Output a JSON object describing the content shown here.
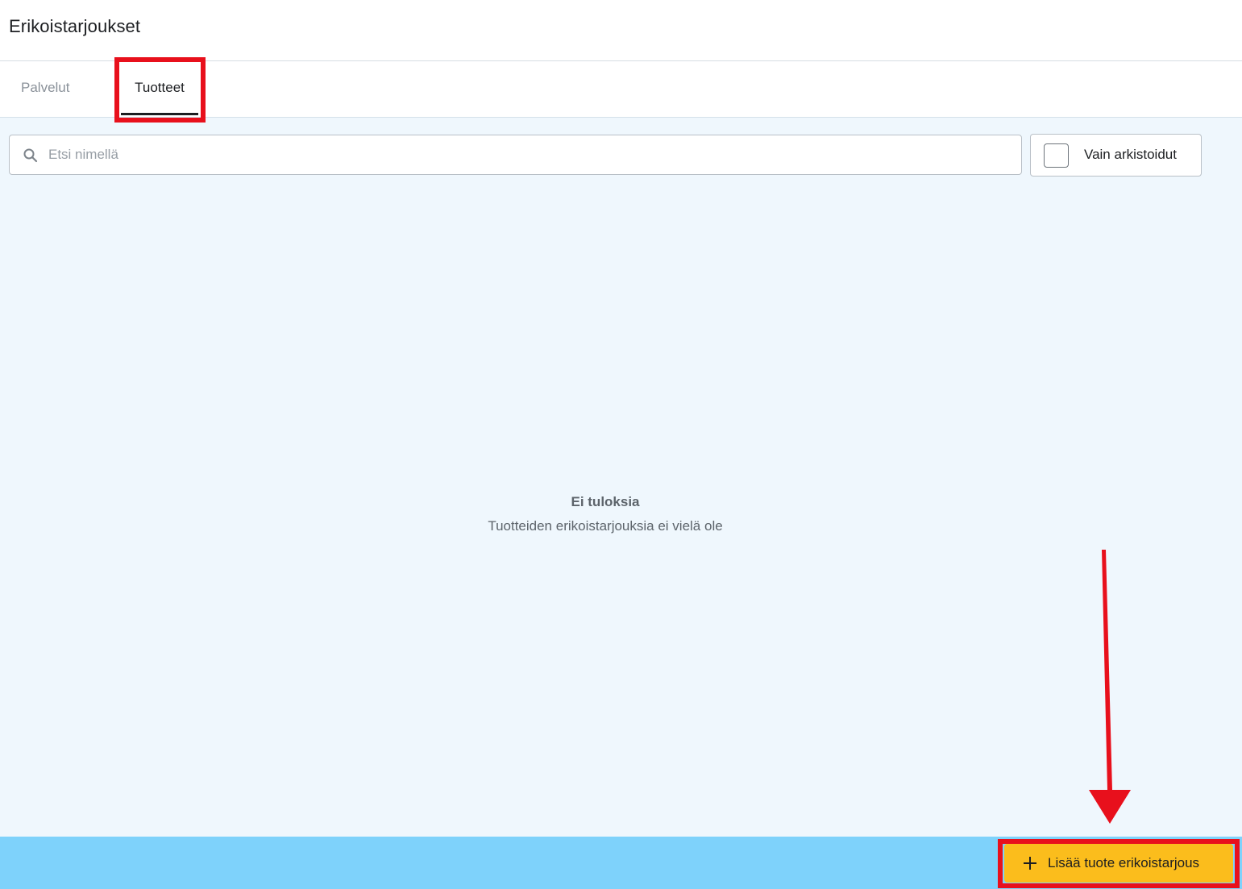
{
  "header": {
    "title": "Erikoistarjoukset"
  },
  "tabs": [
    {
      "label": "Palvelut",
      "active": false
    },
    {
      "label": "Tuotteet",
      "active": true
    }
  ],
  "search": {
    "placeholder": "Etsi nimellä",
    "value": "",
    "icon": "search-icon"
  },
  "filter": {
    "archived_label": "Vain arkistoidut",
    "archived_checked": false
  },
  "empty_state": {
    "title": "Ei tuloksia",
    "description": "Tuotteiden erikoistarjouksia ei vielä ole"
  },
  "footer": {
    "add_button_label": "Lisää tuote erikoistarjous",
    "add_button_icon": "plus-icon"
  },
  "colors": {
    "accent_button": "#fbbd1c",
    "footer_bar": "#7ed2fb",
    "content_background": "#eff7fd",
    "annotation_red": "#e8101c"
  }
}
